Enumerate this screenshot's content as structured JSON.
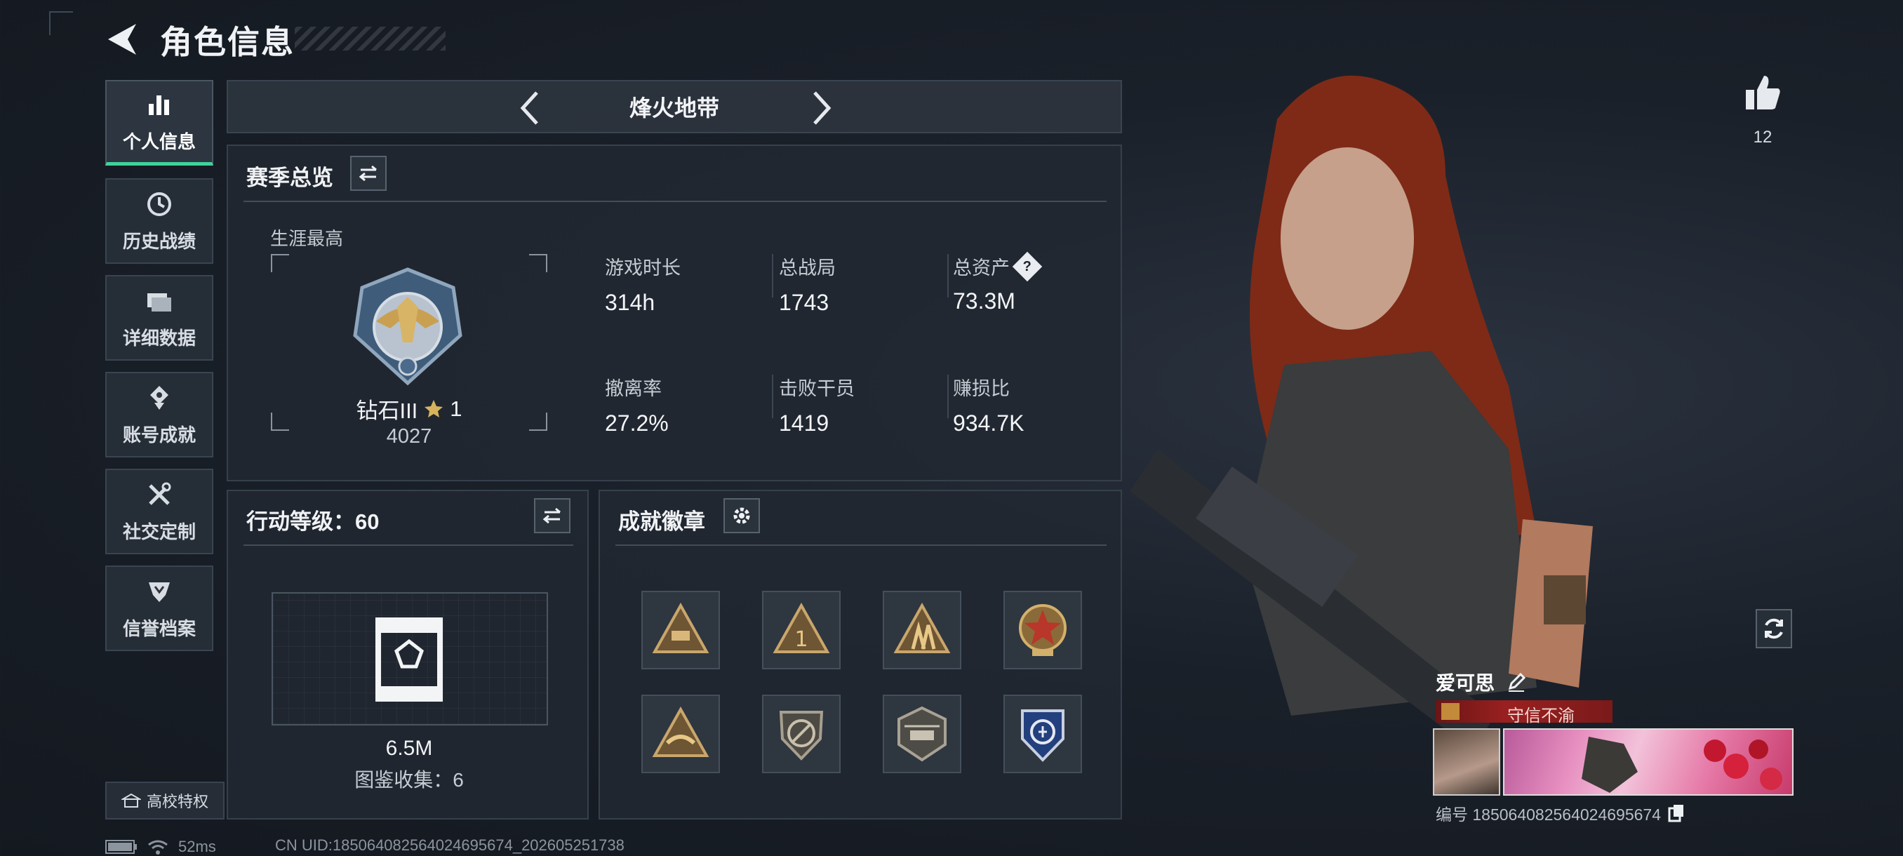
{
  "header": {
    "title": "角色信息"
  },
  "nav": {
    "items": [
      {
        "label": "个人信息",
        "icon": "bar-chart-icon",
        "active": true
      },
      {
        "label": "历史战绩",
        "icon": "history-clock-icon"
      },
      {
        "label": "详细数据",
        "icon": "folder-icon"
      },
      {
        "label": "账号成就",
        "icon": "achievement-icon"
      },
      {
        "label": "社交定制",
        "icon": "tools-icon"
      },
      {
        "label": "信誉档案",
        "icon": "credit-shield-icon"
      }
    ],
    "campus": "高校特权"
  },
  "mode": {
    "name": "烽火地带"
  },
  "season": {
    "title": "赛季总览",
    "career_label": "生涯最高",
    "rank_name": "钻石III",
    "rank_stars": "1",
    "rank_score": "4027",
    "stats": [
      {
        "label": "游戏时长",
        "value": "314h"
      },
      {
        "label": "总战局",
        "value": "1743"
      },
      {
        "label": "总资产",
        "value": "73.3M",
        "has_help": true,
        "help": "?"
      },
      {
        "label": "撤离率",
        "value": "27.2%"
      },
      {
        "label": "击败干员",
        "value": "1419"
      },
      {
        "label": "赚损比",
        "value": "934.7K"
      }
    ]
  },
  "level": {
    "title": "行动等级：60",
    "value": "6.5M",
    "collection": "图鉴收集：6"
  },
  "badges": {
    "title": "成就徽章",
    "items": [
      {
        "icon": "mortar-badge-icon",
        "color": "#a8885a"
      },
      {
        "icon": "rank-one-badge-icon",
        "color": "#c09a55"
      },
      {
        "icon": "soldiers-badge-icon",
        "color": "#b8975a"
      },
      {
        "icon": "star-medal-badge-icon",
        "color": "#b13a2c"
      },
      {
        "icon": "handshake-badge-icon",
        "color": "#b8975a"
      },
      {
        "icon": "no-gun-shield-badge-icon",
        "color": "#8f8a7f"
      },
      {
        "icon": "helicopter-badge-icon",
        "color": "#9a9487"
      },
      {
        "icon": "blue-shield-badge-icon",
        "color": "#2d4f9a"
      }
    ]
  },
  "profile": {
    "likes": "12",
    "name": "爱可思",
    "motto": "守信不渝",
    "account_id": "编号 185064082564024695674"
  },
  "status": {
    "ping": "52ms",
    "uid": "CN UID:185064082564024695674_202605251738"
  },
  "colors": {
    "accent": "#3ed39b",
    "motto_bg": "#8a1d1d"
  }
}
